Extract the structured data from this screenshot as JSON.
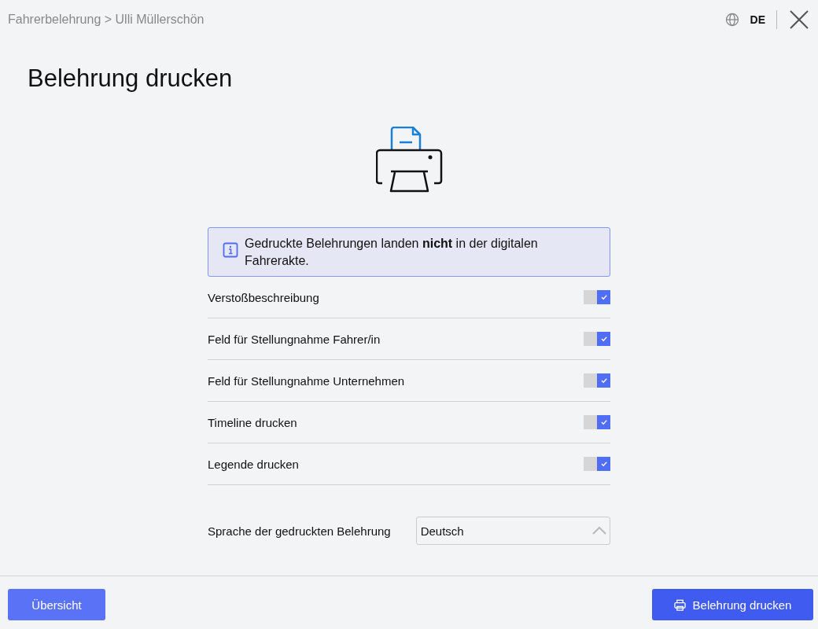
{
  "breadcrumb": "Fahrerbelehrung > Ulli Müllerschön",
  "language_code": "DE",
  "title": "Belehrung drucken",
  "info": "Gedruckte Belehrungen landen **nicht** in der digitalen Fahrerakte.",
  "options": [
    {
      "label": "Verstoßbeschreibung",
      "checked": true
    },
    {
      "label": "Feld für Stellungnahme Fahrer/in",
      "checked": true
    },
    {
      "label": "Feld für Stellungnahme Unternehmen",
      "checked": true
    },
    {
      "label": "Timeline drucken",
      "checked": true
    },
    {
      "label": "Legende drucken",
      "checked": true
    }
  ],
  "language_select": {
    "label": "Sprache der gedruckten Belehrung",
    "value": "Deutsch",
    "expanded": true
  },
  "buttons": {
    "secondary": "Übersicht",
    "primary": "Belehrung drucken"
  }
}
